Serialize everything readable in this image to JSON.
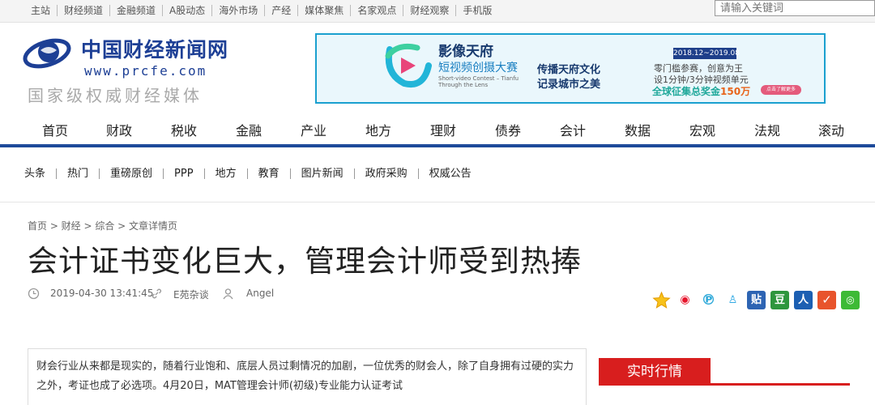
{
  "topbar": {
    "links": [
      "主站",
      "财经频道",
      "金融频道",
      "A股动态",
      "海外市场",
      "产经",
      "媒体聚焦",
      "名家观点",
      "财经观察",
      "手机版"
    ],
    "search_placeholder": "请输入关键词"
  },
  "logo": {
    "name": "中国财经新闻网",
    "url": "www.prcfe.com",
    "slogan": "国家级权威财经媒体"
  },
  "banner": {
    "title": "影像天府",
    "subtitle": "短视频创摄大赛",
    "small_en1": "Short-video Contest – Tianfu",
    "small_en2": "Through the Lens",
    "line1": "传播天府文化",
    "line2": "记录城市之美",
    "date": "2018.12~2019.08",
    "right1": "零门槛参赛，创意为王",
    "right2": "设1分钟/3分钟视频单元",
    "prize_prefix": "全球征集总奖金",
    "prize_amount": "150万",
    "button": "点击了解更多"
  },
  "main_nav": [
    "首页",
    "财政",
    "税收",
    "金融",
    "产业",
    "地方",
    "理财",
    "债券",
    "会计",
    "数据",
    "宏观",
    "法规",
    "滚动"
  ],
  "sub_nav": [
    "头条",
    "热门",
    "重磅原创",
    "PPP",
    "地方",
    "教育",
    "图片新闻",
    "政府采购",
    "权威公告"
  ],
  "breadcrumb": "首页 > 财经 > 综合 > 文章详情页",
  "article": {
    "title": "会计证书变化巨大，管理会计师受到热捧",
    "datetime": "2019-04-30 13:41:45",
    "source": "E苑杂谈",
    "author": "Angel",
    "body": "财会行业从来都是现实的，随着行业饱和、底层人员过剩情况的加剧，一位优秀的财会人，除了自身拥有过硬的实力之外，考证也成了必选项。4月20日，MAT管理会计师(初级)专业能力认证考试"
  },
  "share_icons": [
    {
      "name": "favorite-icon",
      "glyph": "☆",
      "color": "#ffffff"
    },
    {
      "name": "weibo-icon",
      "glyph": "微",
      "color": "#e6162d"
    },
    {
      "name": "tencent-weibo-icon",
      "glyph": "P",
      "color": "#2aa7d8"
    },
    {
      "name": "qq-icon",
      "glyph": "Q",
      "color": "#1a9fe0"
    },
    {
      "name": "tieba-icon",
      "glyph": "贴",
      "color": "#2d64b3"
    },
    {
      "name": "douban-icon",
      "glyph": "豆",
      "color": "#2e963d"
    },
    {
      "name": "renren-icon",
      "glyph": "人",
      "color": "#1c5fb2"
    },
    {
      "name": "kaixin-icon",
      "glyph": "开",
      "color": "#e8542c"
    },
    {
      "name": "wechat-icon",
      "glyph": "微",
      "color": "#3dba36"
    }
  ],
  "sidebar": {
    "realtime_tab": "实时行情"
  }
}
